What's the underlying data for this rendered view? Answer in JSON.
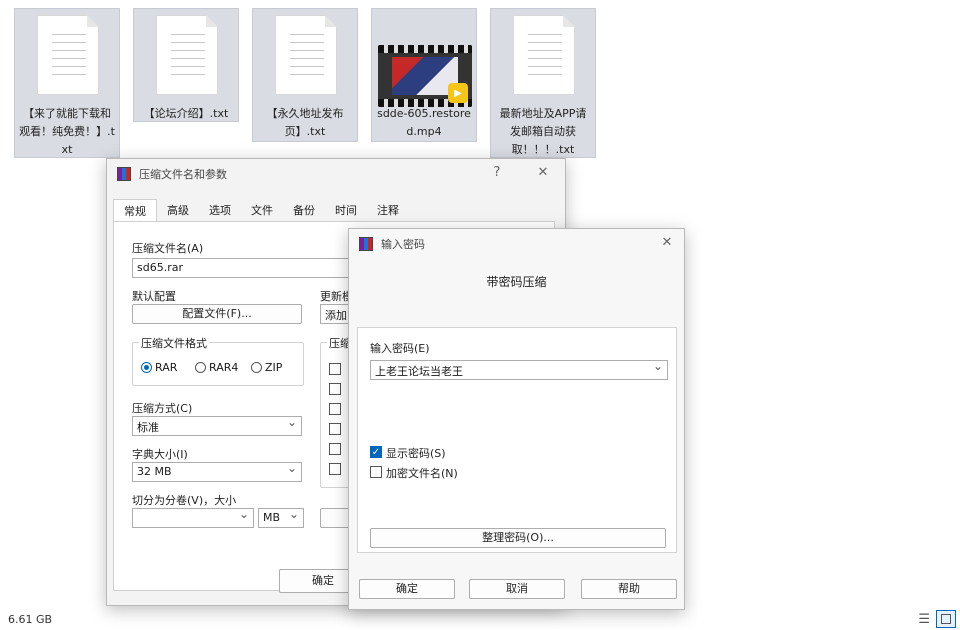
{
  "files": [
    {
      "name": "【来了就能下载和观看！纯免费！】.txt",
      "type": "text"
    },
    {
      "name": "【论坛介绍】.txt",
      "type": "text"
    },
    {
      "name": "【永久地址发布页】.txt",
      "type": "text"
    },
    {
      "name": "sdde-605.restored.mp4",
      "type": "video"
    },
    {
      "name": "最新地址及APP请发邮箱自动获取！！！.txt",
      "type": "text"
    }
  ],
  "status": {
    "size": "6.61 GB"
  },
  "archive_dialog": {
    "title": "压缩文件名和参数",
    "help_btn": "?",
    "close_btn": "✕",
    "tabs": [
      "常规",
      "高级",
      "选项",
      "文件",
      "备份",
      "时间",
      "注释"
    ],
    "archive_name_label": "压缩文件名(A)",
    "archive_name_value": "sd65.rar",
    "default_config_label": "默认配置",
    "config_button": "配置文件(F)...",
    "update_label": "更新模",
    "update_value": "添加",
    "format_group_label": "压缩文件格式",
    "formats": [
      "RAR",
      "RAR4",
      "ZIP"
    ],
    "selected_format": "RAR",
    "options_group_label": "压缩",
    "method_label": "压缩方式(C)",
    "method_value": "标准",
    "dict_label": "字典大小(I)",
    "dict_value": "32 MB",
    "split_label": "切分为分卷(V)，大小",
    "split_value": "",
    "split_unit": "MB",
    "ok_button": "确定"
  },
  "password_dialog": {
    "title": "输入密码",
    "close_btn": "✕",
    "heading": "带密码压缩",
    "password_label": "输入密码(E)",
    "password_value": "上老王论坛当老王",
    "show_password_label": "显示密码(S)",
    "show_password_checked": true,
    "encrypt_names_label": "加密文件名(N)",
    "encrypt_names_checked": false,
    "organize_button": "整理密码(O)...",
    "ok_button": "确定",
    "cancel_button": "取消",
    "help_button": "帮助"
  }
}
